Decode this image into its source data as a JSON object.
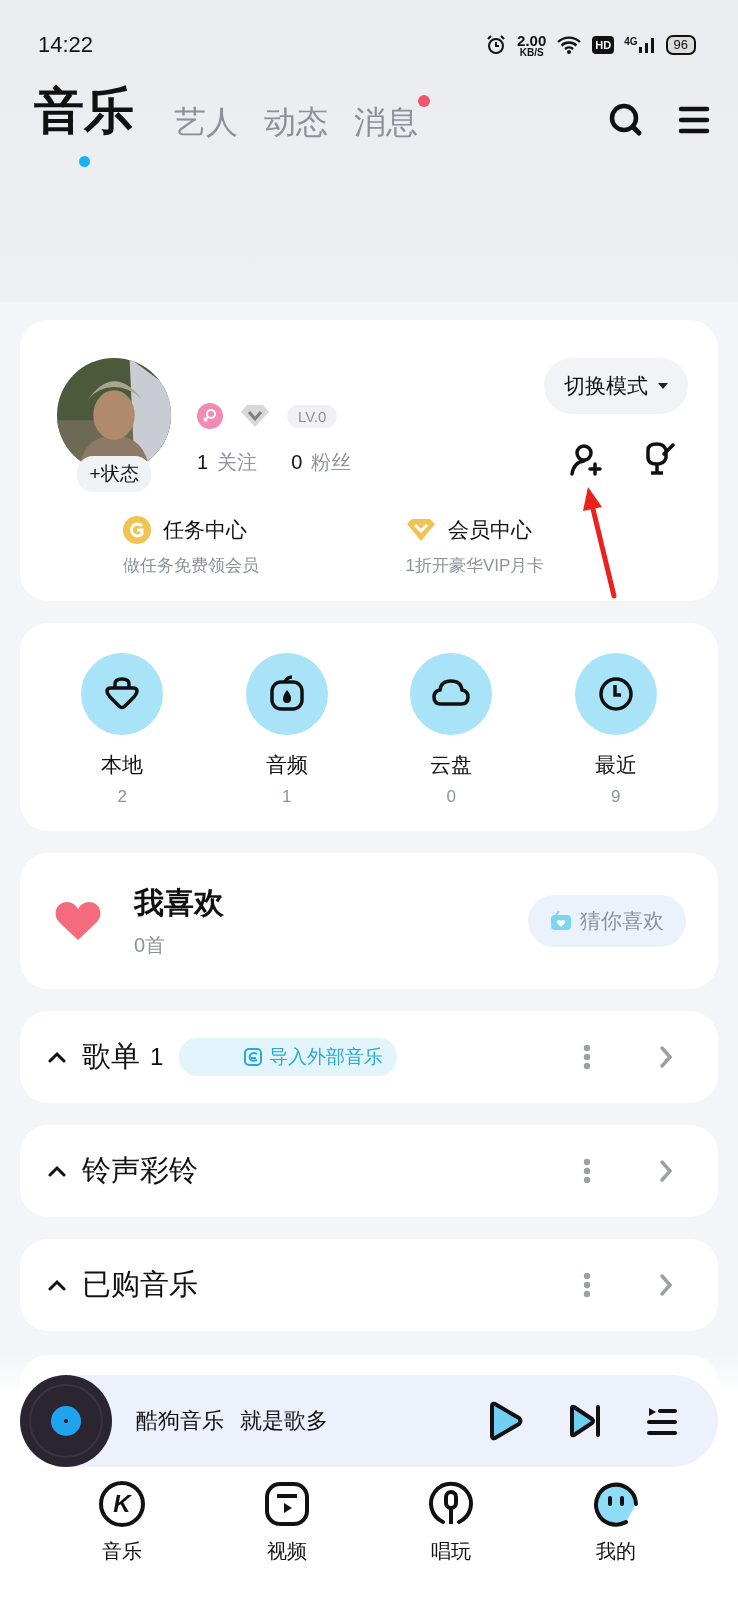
{
  "status_bar": {
    "time": "14:22",
    "net_speed": "2.00",
    "net_unit": "KB/S",
    "hd": "HD",
    "network": "4G",
    "battery": "96"
  },
  "tabs": [
    {
      "label": "音乐",
      "selected": true,
      "badge": false
    },
    {
      "label": "艺人",
      "selected": false,
      "badge": false
    },
    {
      "label": "动态",
      "selected": false,
      "badge": false
    },
    {
      "label": "消息",
      "selected": false,
      "badge": true
    }
  ],
  "profile": {
    "status_button": "+状态",
    "level": "LV.0",
    "following_count": "1",
    "following_label": "关注",
    "fans_count": "0",
    "fans_label": "粉丝",
    "mode_button": "切换模式",
    "links": [
      {
        "kind": "task",
        "title": "任务中心",
        "subtitle": "做任务免费领会员"
      },
      {
        "kind": "vip",
        "title": "会员中心",
        "subtitle": "1折开豪华VIP月卡"
      }
    ]
  },
  "shortcuts": [
    {
      "kind": "local",
      "label": "本地",
      "count": "2"
    },
    {
      "kind": "audio",
      "label": "音频",
      "count": "1"
    },
    {
      "kind": "cloud",
      "label": "云盘",
      "count": "0"
    },
    {
      "kind": "recent",
      "label": "最近",
      "count": "9"
    }
  ],
  "favorites": {
    "title": "我喜欢",
    "count": "0首",
    "button": "猜你喜欢"
  },
  "sections": [
    {
      "title": "歌单",
      "count": "1",
      "badge": "导入外部音乐",
      "expanded": true
    },
    {
      "title": "铃声彩铃",
      "expanded": true
    },
    {
      "title": "已购音乐",
      "expanded": true
    }
  ],
  "player": {
    "title": "酷狗音乐",
    "slogan": "就是歌多"
  },
  "nav": [
    {
      "kind": "music",
      "label": "音乐",
      "logo_letter": "K",
      "selected": false
    },
    {
      "kind": "video",
      "label": "视频",
      "selected": false
    },
    {
      "kind": "sing",
      "label": "唱玩",
      "selected": false
    },
    {
      "kind": "mine",
      "label": "我的",
      "selected": true
    }
  ]
}
